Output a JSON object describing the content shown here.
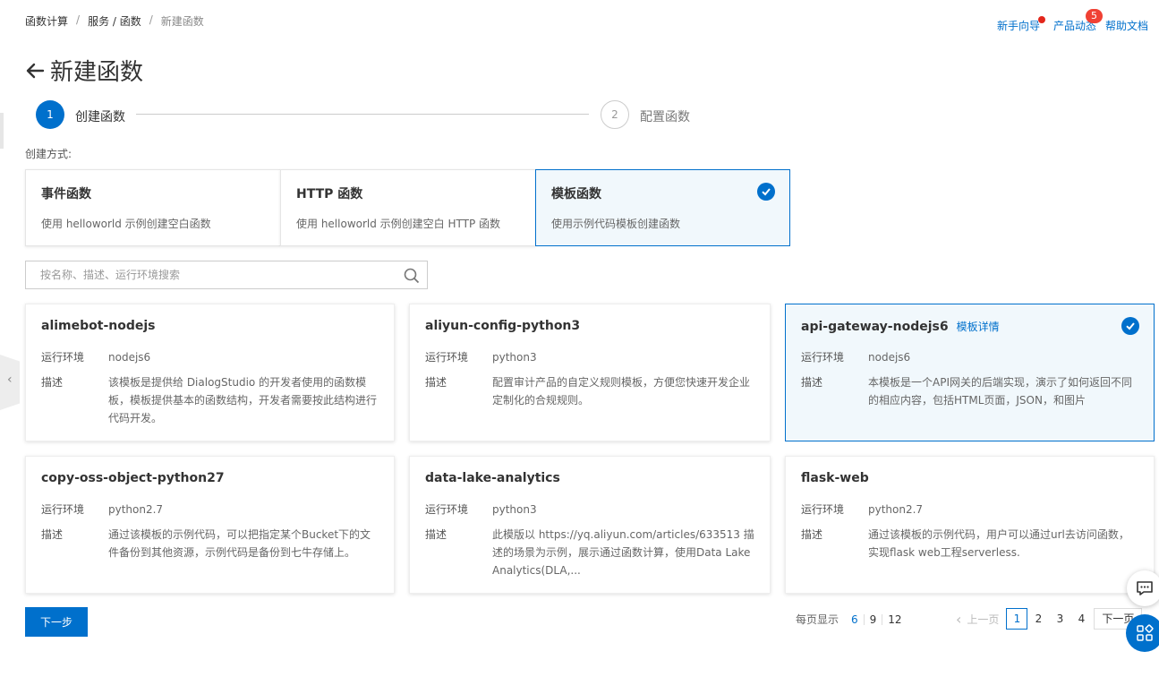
{
  "breadcrumb": [
    "函数计算",
    "服务 / 函数",
    "新建函数"
  ],
  "header": {
    "links": [
      {
        "label": "新手向导",
        "dot": true
      },
      {
        "label": "产品动态",
        "badge": "5"
      },
      {
        "label": "帮助文档"
      }
    ]
  },
  "page": {
    "title": "新建函数"
  },
  "steps": [
    {
      "index": "1",
      "label": "创建函数",
      "state": "active"
    },
    {
      "index": "2",
      "label": "配置函数",
      "state": "pending"
    }
  ],
  "creation": {
    "label": "创建方式:",
    "methods": [
      {
        "title": "事件函数",
        "desc": "使用 helloworld 示例创建空白函数",
        "selected": false
      },
      {
        "title": "HTTP 函数",
        "desc": "使用 helloworld 示例创建空白 HTTP 函数",
        "selected": false
      },
      {
        "title": "模板函数",
        "desc": "使用示例代码模板创建函数",
        "selected": true
      }
    ]
  },
  "search": {
    "placeholder": "按名称、描述、运行环境搜索",
    "value": ""
  },
  "labels": {
    "runtime": "运行环境",
    "desc": "描述",
    "detail_link": "模板详情"
  },
  "templates": [
    {
      "name": "alimebot-nodejs",
      "runtime": "nodejs6",
      "desc": "该模板是提供给 DialogStudio 的开发者使用的函数模板，模板提供基本的函数结构，开发者需要按此结构进行代码开发。",
      "selected": false
    },
    {
      "name": "aliyun-config-python3",
      "runtime": "python3",
      "desc": "配置审计产品的自定义规则模板，方便您快速开发企业定制化的合规规则。",
      "selected": false
    },
    {
      "name": "api-gateway-nodejs6",
      "runtime": "nodejs6",
      "desc": "本模板是一个API网关的后端实现，演示了如何返回不同的相应内容，包括HTML页面，JSON，和图片",
      "selected": true
    },
    {
      "name": "copy-oss-object-python27",
      "runtime": "python2.7",
      "desc": "通过该模板的示例代码，可以把指定某个Bucket下的文件备份到其他资源，示例代码是备份到七牛存储上。",
      "selected": false
    },
    {
      "name": "data-lake-analytics",
      "runtime": "python3",
      "desc": "此模版以 https://yq.aliyun.com/articles/633513 描述的场景为示例，展示通过函数计算，使用Data Lake Analytics(DLA,...",
      "selected": false
    },
    {
      "name": "flask-web",
      "runtime": "python2.7",
      "desc": "通过该模板的示例代码，用户可以通过url去访问函数，实现flask web工程serverless.",
      "selected": false
    }
  ],
  "actions": {
    "next": "下一步"
  },
  "pagination": {
    "page_size_label": "每页显示",
    "page_sizes": [
      "6",
      "9",
      "12"
    ],
    "selected_page_size": "6",
    "prev": "上一页",
    "pages": [
      "1",
      "2",
      "3",
      "4"
    ],
    "current_page": "1",
    "next": "下一页"
  },
  "colors": {
    "primary": "#0070cc",
    "badge": "#f04134",
    "selected_bg": "#f1f8fc"
  }
}
